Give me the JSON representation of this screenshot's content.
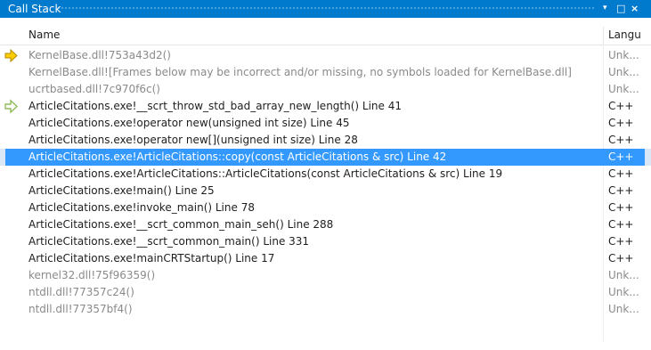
{
  "panel": {
    "title": "Call Stack",
    "controls": {
      "menu": "▾",
      "maximize": "□",
      "close": "×"
    }
  },
  "columns": {
    "name": "Name",
    "language": "Langu"
  },
  "frames": [
    {
      "name": "KernelBase.dll!753a43d2()",
      "language": "Unk...",
      "marker": "current-frame-arrow-icon",
      "muted": true
    },
    {
      "name": "KernelBase.dll![Frames below may be incorrect and/or missing, no symbols loaded for KernelBase.dll]",
      "language": "Unk...",
      "marker": "",
      "muted": true
    },
    {
      "name": "ucrtbased.dll!7c970f6c()",
      "language": "Unk...",
      "marker": "",
      "muted": true
    },
    {
      "name": "ArticleCitations.exe!__scrt_throw_std_bad_array_new_length() Line 41",
      "language": "C++",
      "marker": "call-return-arrow-icon",
      "muted": false
    },
    {
      "name": "ArticleCitations.exe!operator new(unsigned int size) Line 45",
      "language": "C++",
      "marker": "",
      "muted": false
    },
    {
      "name": "ArticleCitations.exe!operator new[](unsigned int size) Line 28",
      "language": "C++",
      "marker": "",
      "muted": false
    },
    {
      "name": "ArticleCitations.exe!ArticleCitations::copy(const ArticleCitations & src) Line 42",
      "language": "C++",
      "marker": "",
      "muted": false,
      "selected": true
    },
    {
      "name": "ArticleCitations.exe!ArticleCitations::ArticleCitations(const ArticleCitations & src) Line 19",
      "language": "C++",
      "marker": "",
      "muted": false
    },
    {
      "name": "ArticleCitations.exe!main() Line 25",
      "language": "C++",
      "marker": "",
      "muted": false
    },
    {
      "name": "ArticleCitations.exe!invoke_main() Line 78",
      "language": "C++",
      "marker": "",
      "muted": false
    },
    {
      "name": "ArticleCitations.exe!__scrt_common_main_seh() Line 288",
      "language": "C++",
      "marker": "",
      "muted": false
    },
    {
      "name": "ArticleCitations.exe!__scrt_common_main() Line 331",
      "language": "C++",
      "marker": "",
      "muted": false
    },
    {
      "name": "ArticleCitations.exe!mainCRTStartup() Line 17",
      "language": "C++",
      "marker": "",
      "muted": false
    },
    {
      "name": "kernel32.dll!75f96359()",
      "language": "Unk...",
      "marker": "",
      "muted": true
    },
    {
      "name": "ntdll.dll!77357c24()",
      "language": "Unk...",
      "marker": "",
      "muted": true
    },
    {
      "name": "ntdll.dll!77357bf4()",
      "language": "Unk...",
      "marker": "",
      "muted": true
    }
  ],
  "colors": {
    "accent": "#007acc",
    "selection": "#3399ff",
    "current_frame_arrow": "#ffcc00",
    "call_return_arrow": "#8fbc5a"
  }
}
